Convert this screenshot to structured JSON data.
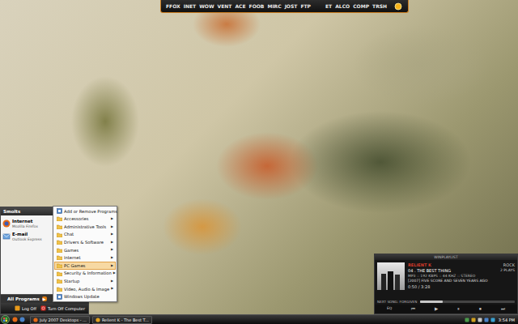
{
  "launcher": {
    "items": [
      "FFOX",
      "INET",
      "WOW",
      "VENT",
      "ACE",
      "FOOB",
      "MIRC",
      "JOST",
      "FTP",
      "ET",
      "ALCO",
      "COMP",
      "TRSH"
    ]
  },
  "start_menu": {
    "user": "Smolts",
    "pinned": [
      {
        "title": "Internet",
        "subtitle": "Mozilla Firefox"
      },
      {
        "title": "E-mail",
        "subtitle": "Outlook Express"
      }
    ],
    "all_programs": "All Programs",
    "arrow": "▶",
    "log_off": "Log Off",
    "turn_off": "Turn Off Computer"
  },
  "programs_menu": {
    "items": [
      {
        "label": "Add or Remove Programs",
        "kind": "app",
        "selected": false
      },
      {
        "label": "Accessories",
        "kind": "folder",
        "selected": false
      },
      {
        "label": "Administrative Tools",
        "kind": "folder",
        "selected": false
      },
      {
        "label": "Chat",
        "kind": "folder",
        "selected": false
      },
      {
        "label": "Drivers & Software",
        "kind": "folder",
        "selected": false
      },
      {
        "label": "Games",
        "kind": "folder",
        "selected": false
      },
      {
        "label": "Internet",
        "kind": "folder",
        "selected": false
      },
      {
        "label": "PC Games",
        "kind": "folder",
        "selected": true
      },
      {
        "label": "Security & Information",
        "kind": "folder",
        "selected": false
      },
      {
        "label": "Startup",
        "kind": "folder",
        "selected": false
      },
      {
        "label": "Video, Audio & Image",
        "kind": "folder",
        "selected": false
      },
      {
        "label": "Windows Update",
        "kind": "app",
        "selected": false
      }
    ],
    "submenu_arrow": "▶"
  },
  "player": {
    "title": "WINPLAYLIST",
    "artist": "RELIENT K",
    "genre": "ROCK",
    "track": "04 . THE BEST THING",
    "plays": "2 PLAYS",
    "format": "MP3 :: 192 KBPS :: 44 KHZ :: STEREO",
    "album": "[2007] FIVE SCORE AND SEVEN YEARS AGO",
    "next": "NEXT SONG: FORGIVEN",
    "time": "0:50 / 3:28",
    "level": 0.24,
    "controls": [
      "EQ",
      "⏮",
      "▶",
      "⏸",
      "⏹",
      "⏭"
    ]
  },
  "taskbar": {
    "tasks": [
      {
        "label": "July 2007 Desktops - ...",
        "selected": false
      },
      {
        "label": "Relient K - The Best T...",
        "selected": false
      }
    ],
    "clock": "3:54 PM"
  }
}
